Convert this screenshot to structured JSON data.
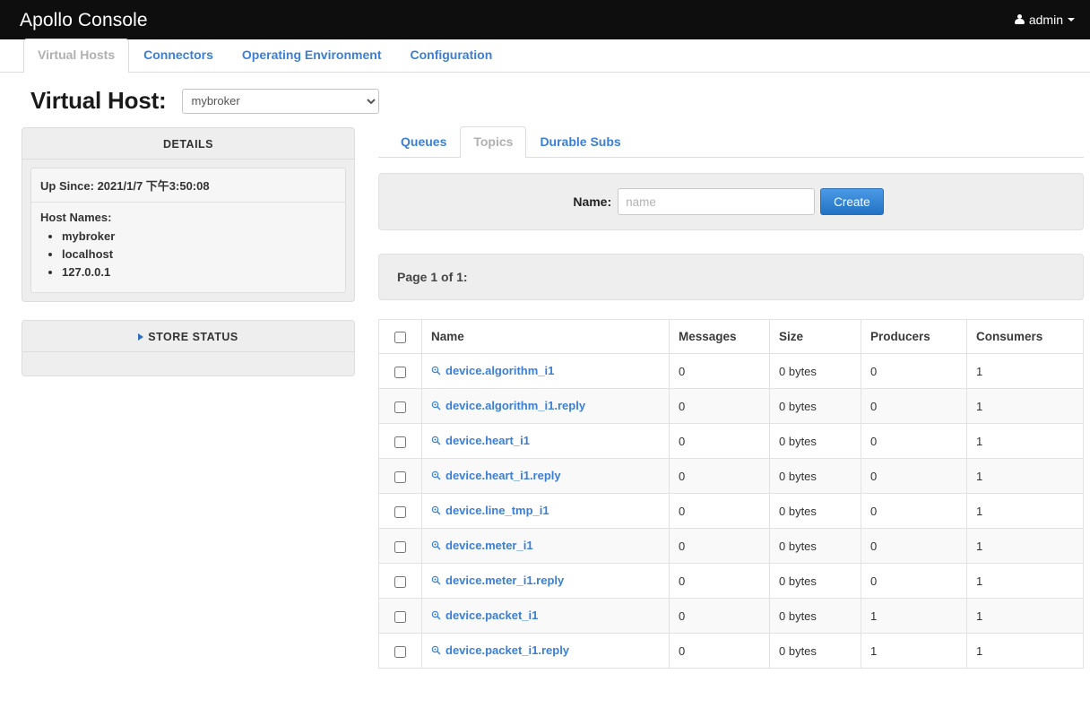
{
  "navbar": {
    "brand": "Apollo Console",
    "user_label": "admin",
    "user_icon": "user-icon",
    "caret_icon": "caret-down-icon"
  },
  "main_tabs": [
    {
      "label": "Virtual Hosts",
      "active": true
    },
    {
      "label": "Connectors",
      "active": false
    },
    {
      "label": "Operating Environment",
      "active": false
    },
    {
      "label": "Configuration",
      "active": false
    }
  ],
  "vhost": {
    "title": "Virtual Host:",
    "selected": "mybroker",
    "options": [
      "mybroker"
    ]
  },
  "details_panel": {
    "title": "DETAILS",
    "up_since": "Up Since: 2021/1/7 下午3:50:08",
    "host_names_label": "Host Names:",
    "host_names": [
      "mybroker",
      "localhost",
      "127.0.0.1"
    ]
  },
  "store_panel": {
    "title": "STORE STATUS",
    "toggle_icon": "triangle-right-icon",
    "expanded": false
  },
  "sub_tabs": [
    {
      "label": "Queues",
      "active": false
    },
    {
      "label": "Topics",
      "active": true
    },
    {
      "label": "Durable Subs",
      "active": false
    }
  ],
  "create_form": {
    "label": "Name:",
    "value": "",
    "placeholder": "name",
    "button_label": "Create"
  },
  "page_bar": {
    "text": "Page 1 of 1:"
  },
  "table": {
    "select_all_checked": false,
    "columns": [
      "Name",
      "Messages",
      "Size",
      "Producers",
      "Consumers"
    ],
    "row_icon": "magnifier-icon",
    "rows": [
      {
        "name": "device.algorithm_i1",
        "messages": "0",
        "size": "0 bytes",
        "producers": "0",
        "consumers": "1",
        "checked": false
      },
      {
        "name": "device.algorithm_i1.reply",
        "messages": "0",
        "size": "0 bytes",
        "producers": "0",
        "consumers": "1",
        "checked": false
      },
      {
        "name": "device.heart_i1",
        "messages": "0",
        "size": "0 bytes",
        "producers": "0",
        "consumers": "1",
        "checked": false
      },
      {
        "name": "device.heart_i1.reply",
        "messages": "0",
        "size": "0 bytes",
        "producers": "0",
        "consumers": "1",
        "checked": false
      },
      {
        "name": "device.line_tmp_i1",
        "messages": "0",
        "size": "0 bytes",
        "producers": "0",
        "consumers": "1",
        "checked": false
      },
      {
        "name": "device.meter_i1",
        "messages": "0",
        "size": "0 bytes",
        "producers": "0",
        "consumers": "1",
        "checked": false
      },
      {
        "name": "device.meter_i1.reply",
        "messages": "0",
        "size": "0 bytes",
        "producers": "0",
        "consumers": "1",
        "checked": false
      },
      {
        "name": "device.packet_i1",
        "messages": "0",
        "size": "0 bytes",
        "producers": "1",
        "consumers": "1",
        "checked": false
      },
      {
        "name": "device.packet_i1.reply",
        "messages": "0",
        "size": "0 bytes",
        "producers": "1",
        "consumers": "1",
        "checked": false
      }
    ]
  },
  "colors": {
    "navbar_bg": "#0e0e0e",
    "link": "#3b7fd4",
    "panel_bg": "#eeeeee",
    "border": "#dddddd",
    "button_blue": "#2272c4"
  }
}
